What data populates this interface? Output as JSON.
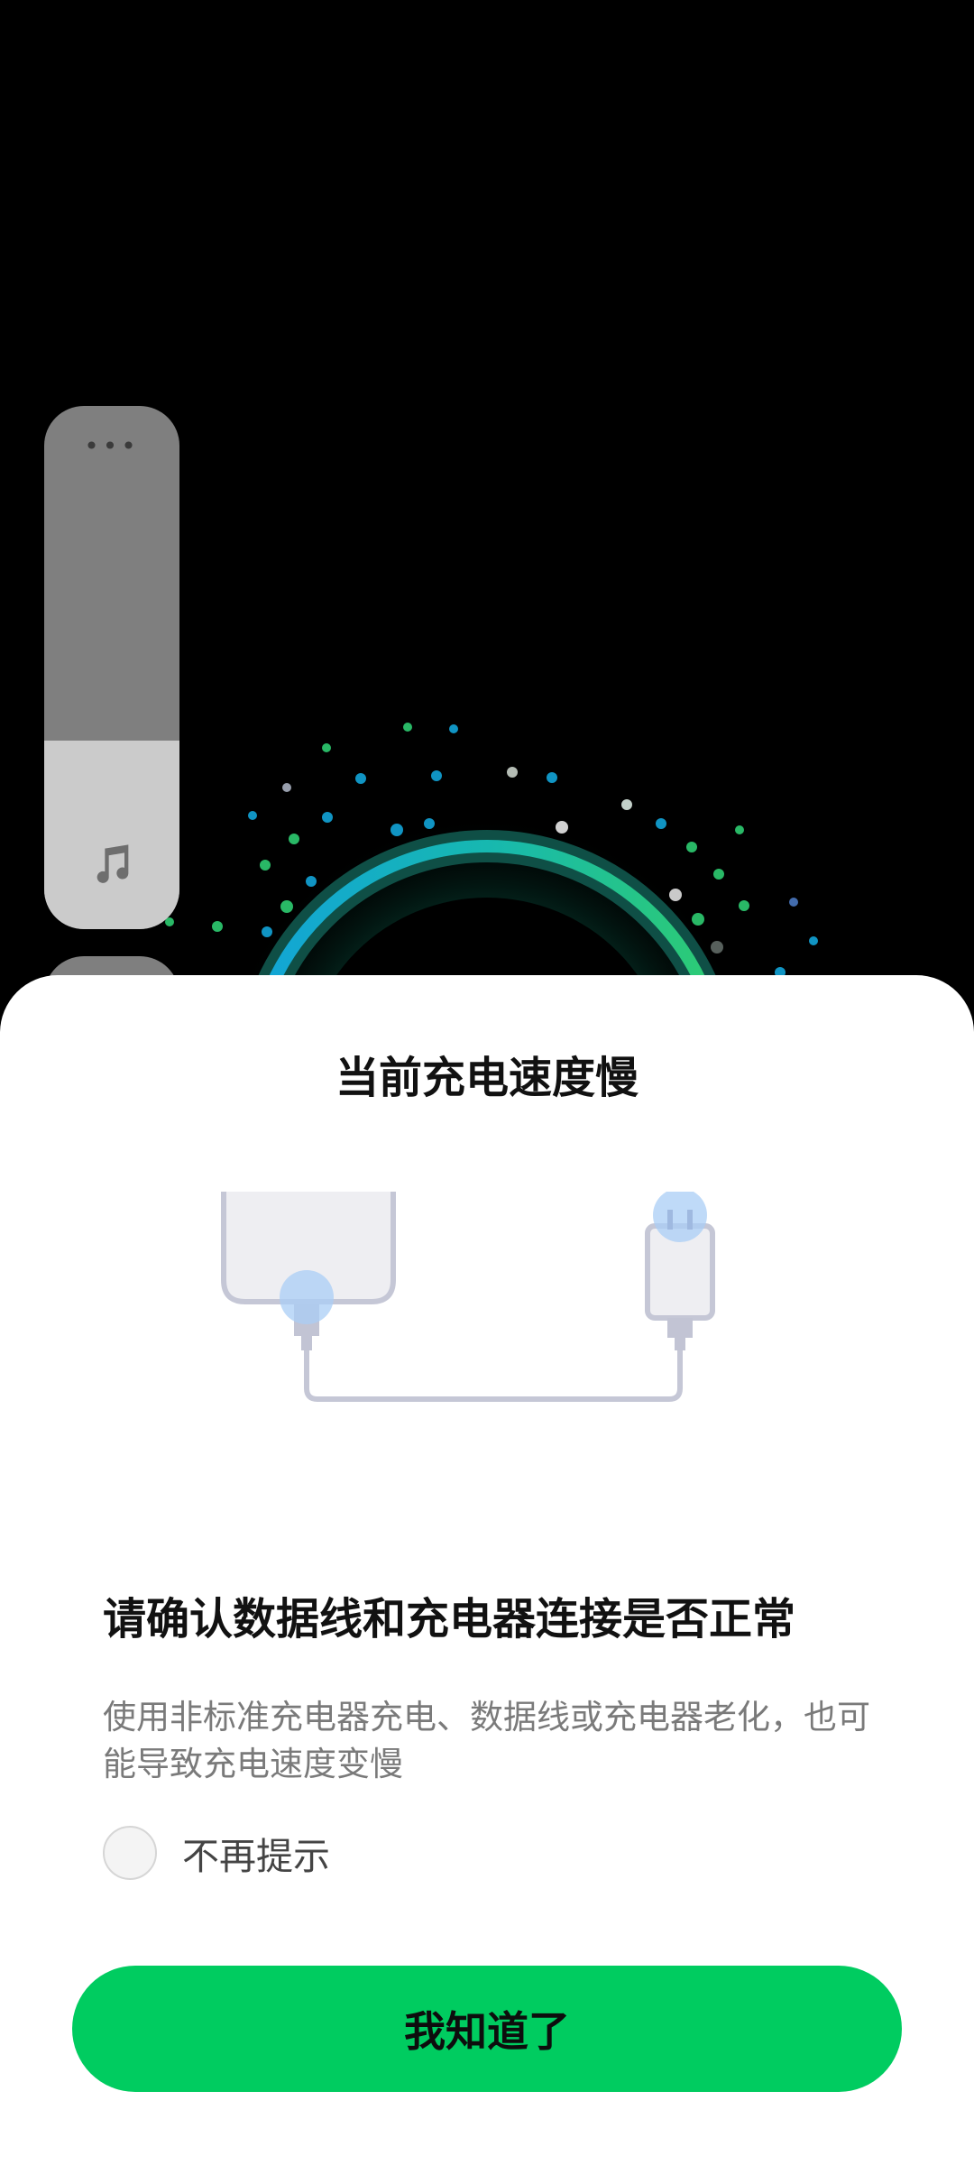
{
  "dialog": {
    "title": "当前充电速度慢",
    "heading": "请确认数据线和充电器连接是否正常",
    "description": "使用非标准充电器充电、数据线或充电器老化，也可能导致充电速度变慢",
    "dont_show_again_label": "不再提示",
    "dont_show_again_checked": false,
    "confirm_button_label": "我知道了"
  },
  "volume_panel": {
    "menu_icon": "more-dots-icon",
    "media_icon": "music-note-icon",
    "level": 0.36
  },
  "colors": {
    "accent_green": "#00cc60",
    "sheet_background": "#ffffff",
    "ring_blue": "#12a4d8",
    "ring_green": "#2ecc71"
  }
}
